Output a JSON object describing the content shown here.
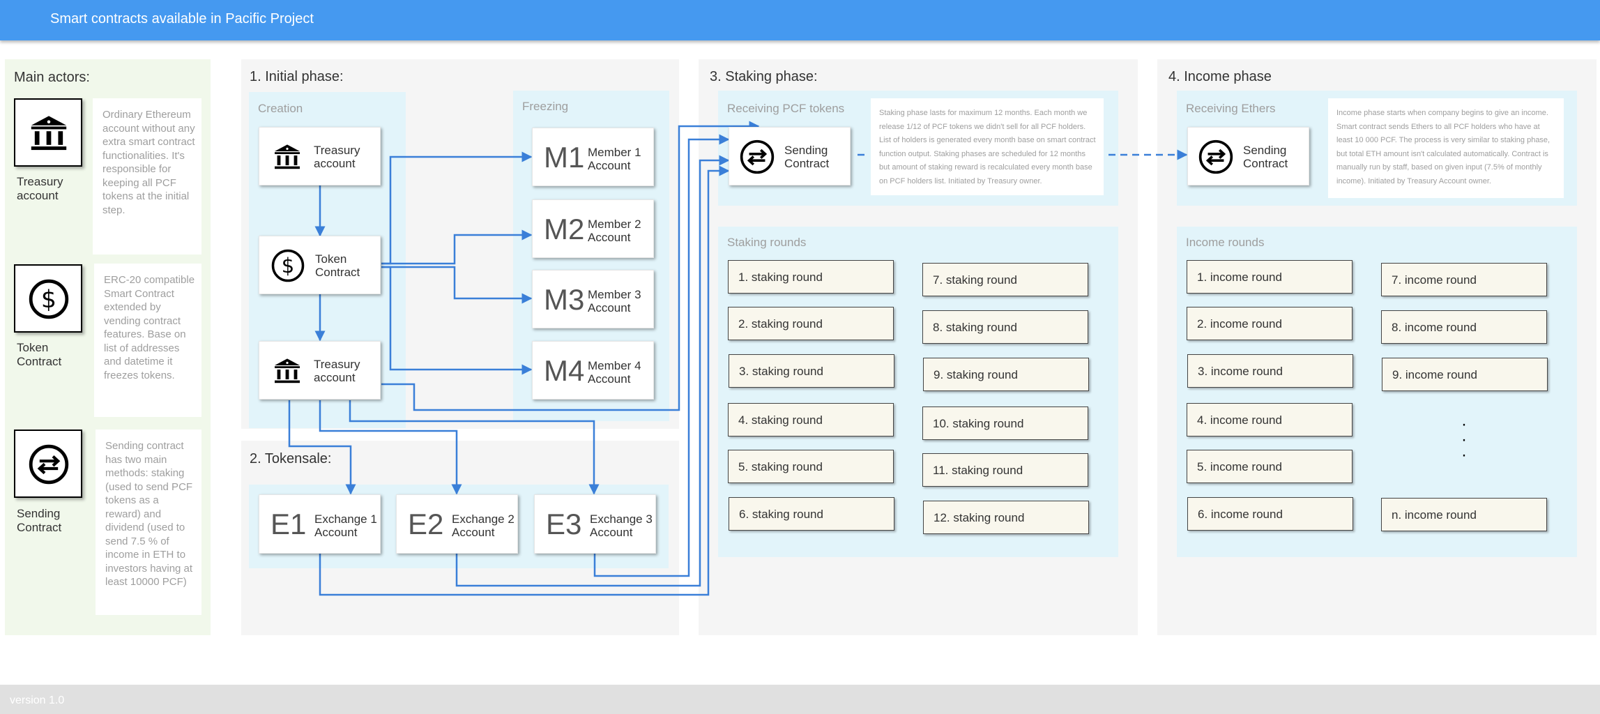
{
  "header": {
    "title": "Smart contracts available in Pacific Project"
  },
  "footer": {
    "version": "version 1.0"
  },
  "actors": {
    "title": "Main actors:",
    "items": [
      {
        "label_line1": "Treasury",
        "label_line2": "account",
        "icon": "bank-icon",
        "description": "Ordinary Ethereum account without any extra smart contract functionalities. It's responsible for keeping all PCF tokens at the initial step."
      },
      {
        "label_line1": "Token",
        "label_line2": "Contract",
        "icon": "dollar-coin-icon",
        "description": "ERC-20 compatible Smart Contract extended by vending contract features. Base on list of addresses and datetime it freezes tokens."
      },
      {
        "label_line1": "Sending",
        "label_line2": "Contract",
        "icon": "exchange-arrows-icon",
        "description": "Sending contract has two main methods: staking (used to send PCF tokens as a reward) and dividend (used to send 7.5 % of income in ETH to investors having at least 10000 PCF)"
      }
    ]
  },
  "initial": {
    "title": "1. Initial phase:",
    "creation": {
      "title": "Creation",
      "treasury1": {
        "line1": "Treasury",
        "line2": "account"
      },
      "token": {
        "line1": "Token",
        "line2": "Contract"
      },
      "treasury2": {
        "line1": "Treasury",
        "line2": "account"
      }
    },
    "freezing": {
      "title": "Freezing",
      "members": [
        {
          "code": "M1",
          "line1": "Member 1",
          "line2": "Account"
        },
        {
          "code": "M2",
          "line1": "Member 2",
          "line2": "Account"
        },
        {
          "code": "M3",
          "line1": "Member 3",
          "line2": "Account"
        },
        {
          "code": "M4",
          "line1": "Member 4",
          "line2": "Account"
        }
      ]
    }
  },
  "tokensale": {
    "title": "2. Tokensale:",
    "exchanges": [
      {
        "code": "E1",
        "line1": "Exchange 1",
        "line2": "Account"
      },
      {
        "code": "E2",
        "line1": "Exchange 2",
        "line2": "Account"
      },
      {
        "code": "E3",
        "line1": "Exchange 3",
        "line2": "Account"
      }
    ]
  },
  "staking": {
    "title": "3. Staking phase:",
    "receiving_title": "Receiving PCF tokens",
    "contract": {
      "line1": "Sending",
      "line2": "Contract"
    },
    "note": "Staking phase lasts for maximum 12 months. Each month we release 1/12 of PCF tokens we didn't sell for all PCF holders. List of holders is generated every month base on smart contract function output. Staking phases are scheduled for 12 months but amount of staking reward is recalculated every month base on PCF holders list. Initiated by Treasury owner.",
    "rounds_title": "Staking rounds",
    "rounds_left": [
      "1. staking round",
      "2. staking round",
      "3. staking round",
      "4. staking round",
      "5. staking round",
      "6. staking round"
    ],
    "rounds_right": [
      "7. staking round",
      "8. staking round",
      "9. staking round",
      "10. staking round",
      "11. staking round",
      "12. staking round"
    ]
  },
  "income": {
    "title": "4. Income phase",
    "receiving_title": "Receiving Ethers",
    "contract": {
      "line1": "Sending",
      "line2": "Contract"
    },
    "note": "Income phase starts when company begins to give an income. Smart contract sends Ethers to all PCF holders who have at least 10 000 PCF. The process is very similar to staking phase, but total ETH amount isn't calculated automatically. Contract is manually run by staff, based on given input (7.5% of monthly income). Initiated by Treasury Account owner.",
    "rounds_title": "Income rounds",
    "rounds_left": [
      "1. income round",
      "2. income round",
      "3. income round",
      "4. income round",
      "5. income round",
      "6. income round"
    ],
    "rounds_right": [
      "7. income round",
      "8. income round",
      "9. income round",
      "n. income round"
    ],
    "ellipsis": [
      "·",
      "·",
      "·"
    ]
  },
  "colors": {
    "header": "#4599f0",
    "arrow": "#3a7fd8",
    "panel": "#f5f5f5",
    "subpanel": "#e2f4fa",
    "actors_panel": "#f1f8eb"
  }
}
